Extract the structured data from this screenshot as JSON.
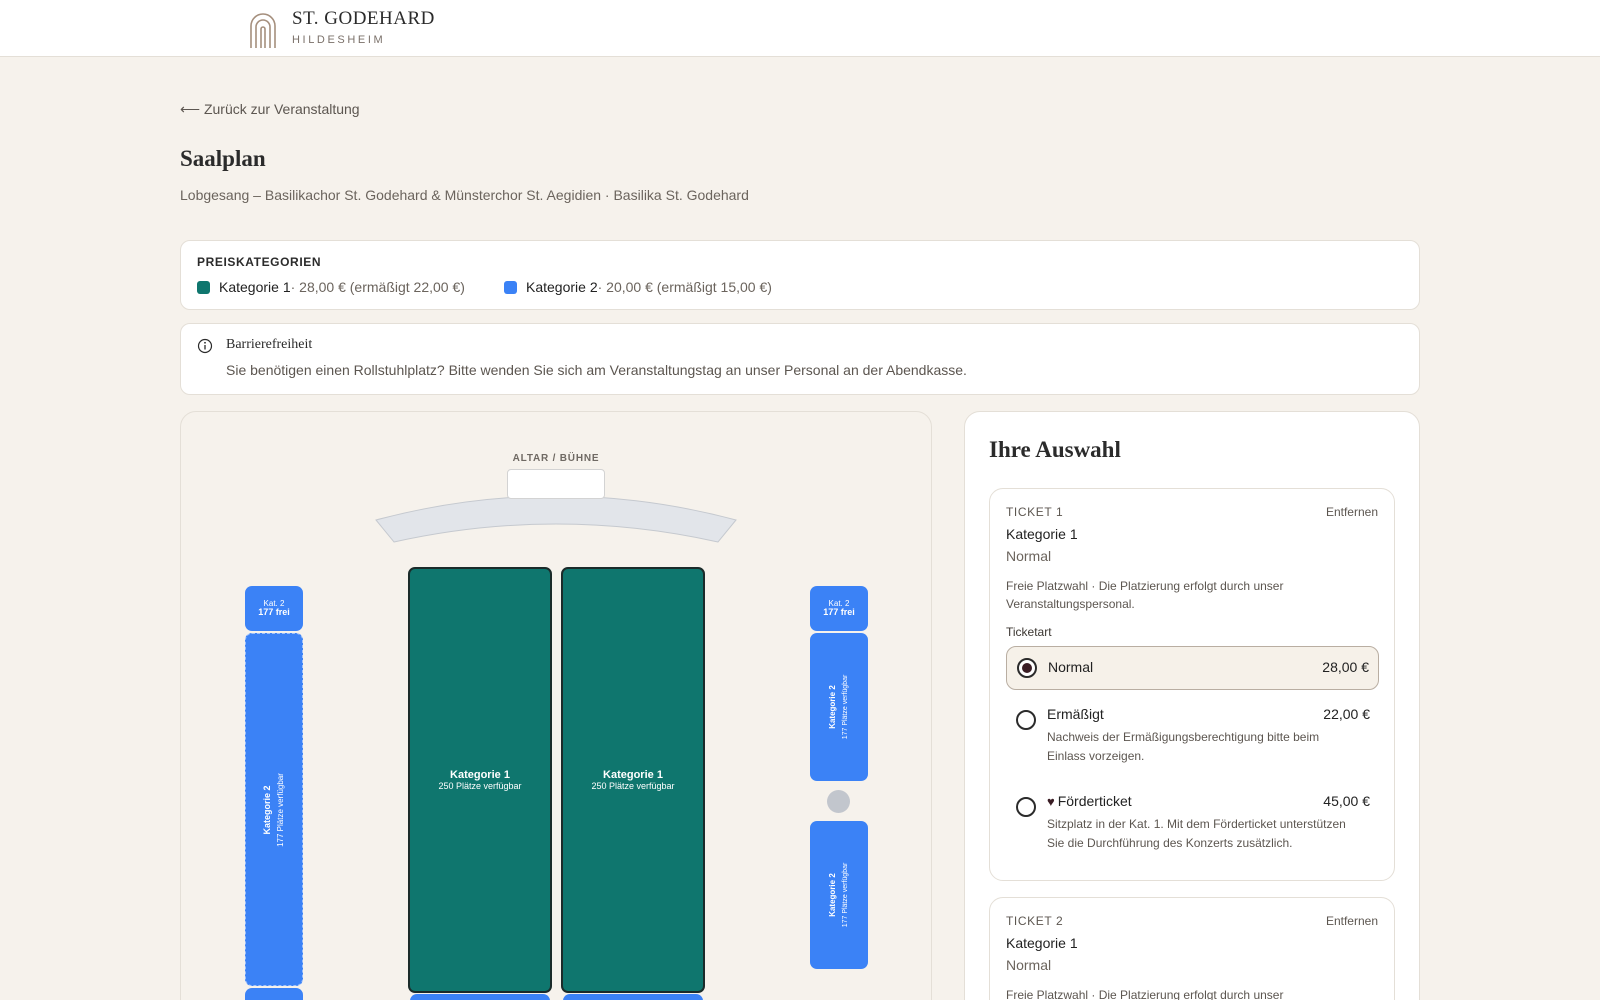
{
  "header": {
    "title": "ST. GODEHARD",
    "subtitle": "HILDESHEIM"
  },
  "nav": {
    "back_label": "⟵ Zurück zur Veranstaltung"
  },
  "page": {
    "title": "Saalplan",
    "subtitle": "Lobgesang – Basilikachor St. Godehard & Münsterchor St. Aegidien · Basilika St. Godehard"
  },
  "price_categories": {
    "heading": "PREISKATEGORIEN",
    "items": [
      {
        "name": "Kategorie 1",
        "price": " · 28,00 € (ermäßigt 22,00 €)",
        "color": "#0f766e"
      },
      {
        "name": "Kategorie 2",
        "price": " · 20,00 € (ermäßigt 15,00 €)",
        "color": "#3b82f6"
      }
    ]
  },
  "accessibility": {
    "title": "Barrierefreiheit",
    "text": "Sie benötigen einen Rollstuhlplatz? Bitte wenden Sie sich am Veranstaltungstag an unser Personal an der Abendkasse."
  },
  "seat_plan": {
    "stage_label": "ALTAR / BÜHNE",
    "blocks": {
      "left_small": {
        "title": "Kat. 2",
        "sub": "177 frei"
      },
      "left_tall": {
        "title": "Kategorie 2",
        "sub": "177 Plätze verfügbar"
      },
      "center_left": {
        "title": "Kategorie 1",
        "sub": "250 Plätze verfügbar"
      },
      "center_right": {
        "title": "Kategorie 1",
        "sub": "250 Plätze verfügbar"
      },
      "right_small": {
        "title": "Kat. 2",
        "sub": "177 frei"
      },
      "right_upper": {
        "title": "Kategorie 2",
        "sub": "177 Plätze verfügbar"
      },
      "right_lower": {
        "title": "Kategorie 2",
        "sub": "177 Plätze verfügbar"
      }
    }
  },
  "selection": {
    "title": "Ihre Auswahl",
    "tickets": [
      {
        "number": "TICKET 1",
        "remove_label": "Entfernen",
        "category": "Kategorie 1",
        "type": "Normal",
        "note": "Freie Platzwahl · Die Platzierung erfolgt durch unser Veranstaltungspersonal.",
        "ticket_type_label": "Ticketart",
        "options": [
          {
            "name": "Normal",
            "price": "28,00 €",
            "desc": "",
            "selected": true
          },
          {
            "name": "Ermäßigt",
            "price": "22,00 €",
            "desc": "Nachweis der Ermäßigungsberechtigung bitte beim Einlass vorzeigen.",
            "selected": false
          },
          {
            "name": "Förderticket",
            "price": "45,00 €",
            "desc": "Sitzplatz in der Kat. 1. Mit dem Förderticket unterstützen Sie die Durchführung des Konzerts zusätzlich.",
            "selected": false
          }
        ]
      },
      {
        "number": "TICKET 2",
        "remove_label": "Entfernen",
        "category": "Kategorie 1",
        "type": "Normal",
        "note": "Freie Platzwahl · Die Platzierung erfolgt durch unser Veranstaltungspersonal."
      }
    ]
  },
  "colors": {
    "background": "#f6f2ec",
    "category_1": "#0f766e",
    "category_2": "#3b82f6",
    "accent_dark": "#3a1d24"
  }
}
